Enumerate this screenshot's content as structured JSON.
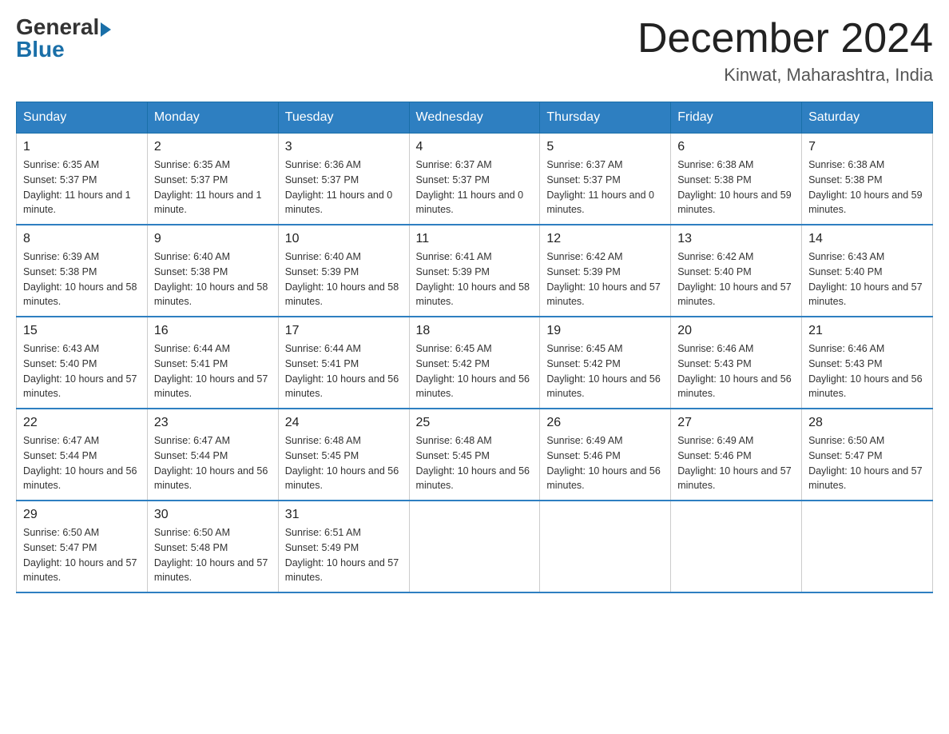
{
  "header": {
    "logo_general": "General",
    "logo_blue": "Blue",
    "month_title": "December 2024",
    "location": "Kinwat, Maharashtra, India"
  },
  "days_of_week": [
    "Sunday",
    "Monday",
    "Tuesday",
    "Wednesday",
    "Thursday",
    "Friday",
    "Saturday"
  ],
  "weeks": [
    [
      {
        "day": "1",
        "sunrise": "6:35 AM",
        "sunset": "5:37 PM",
        "daylight": "11 hours and 1 minute."
      },
      {
        "day": "2",
        "sunrise": "6:35 AM",
        "sunset": "5:37 PM",
        "daylight": "11 hours and 1 minute."
      },
      {
        "day": "3",
        "sunrise": "6:36 AM",
        "sunset": "5:37 PM",
        "daylight": "11 hours and 0 minutes."
      },
      {
        "day": "4",
        "sunrise": "6:37 AM",
        "sunset": "5:37 PM",
        "daylight": "11 hours and 0 minutes."
      },
      {
        "day": "5",
        "sunrise": "6:37 AM",
        "sunset": "5:37 PM",
        "daylight": "11 hours and 0 minutes."
      },
      {
        "day": "6",
        "sunrise": "6:38 AM",
        "sunset": "5:38 PM",
        "daylight": "10 hours and 59 minutes."
      },
      {
        "day": "7",
        "sunrise": "6:38 AM",
        "sunset": "5:38 PM",
        "daylight": "10 hours and 59 minutes."
      }
    ],
    [
      {
        "day": "8",
        "sunrise": "6:39 AM",
        "sunset": "5:38 PM",
        "daylight": "10 hours and 58 minutes."
      },
      {
        "day": "9",
        "sunrise": "6:40 AM",
        "sunset": "5:38 PM",
        "daylight": "10 hours and 58 minutes."
      },
      {
        "day": "10",
        "sunrise": "6:40 AM",
        "sunset": "5:39 PM",
        "daylight": "10 hours and 58 minutes."
      },
      {
        "day": "11",
        "sunrise": "6:41 AM",
        "sunset": "5:39 PM",
        "daylight": "10 hours and 58 minutes."
      },
      {
        "day": "12",
        "sunrise": "6:42 AM",
        "sunset": "5:39 PM",
        "daylight": "10 hours and 57 minutes."
      },
      {
        "day": "13",
        "sunrise": "6:42 AM",
        "sunset": "5:40 PM",
        "daylight": "10 hours and 57 minutes."
      },
      {
        "day": "14",
        "sunrise": "6:43 AM",
        "sunset": "5:40 PM",
        "daylight": "10 hours and 57 minutes."
      }
    ],
    [
      {
        "day": "15",
        "sunrise": "6:43 AM",
        "sunset": "5:40 PM",
        "daylight": "10 hours and 57 minutes."
      },
      {
        "day": "16",
        "sunrise": "6:44 AM",
        "sunset": "5:41 PM",
        "daylight": "10 hours and 57 minutes."
      },
      {
        "day": "17",
        "sunrise": "6:44 AM",
        "sunset": "5:41 PM",
        "daylight": "10 hours and 56 minutes."
      },
      {
        "day": "18",
        "sunrise": "6:45 AM",
        "sunset": "5:42 PM",
        "daylight": "10 hours and 56 minutes."
      },
      {
        "day": "19",
        "sunrise": "6:45 AM",
        "sunset": "5:42 PM",
        "daylight": "10 hours and 56 minutes."
      },
      {
        "day": "20",
        "sunrise": "6:46 AM",
        "sunset": "5:43 PM",
        "daylight": "10 hours and 56 minutes."
      },
      {
        "day": "21",
        "sunrise": "6:46 AM",
        "sunset": "5:43 PM",
        "daylight": "10 hours and 56 minutes."
      }
    ],
    [
      {
        "day": "22",
        "sunrise": "6:47 AM",
        "sunset": "5:44 PM",
        "daylight": "10 hours and 56 minutes."
      },
      {
        "day": "23",
        "sunrise": "6:47 AM",
        "sunset": "5:44 PM",
        "daylight": "10 hours and 56 minutes."
      },
      {
        "day": "24",
        "sunrise": "6:48 AM",
        "sunset": "5:45 PM",
        "daylight": "10 hours and 56 minutes."
      },
      {
        "day": "25",
        "sunrise": "6:48 AM",
        "sunset": "5:45 PM",
        "daylight": "10 hours and 56 minutes."
      },
      {
        "day": "26",
        "sunrise": "6:49 AM",
        "sunset": "5:46 PM",
        "daylight": "10 hours and 56 minutes."
      },
      {
        "day": "27",
        "sunrise": "6:49 AM",
        "sunset": "5:46 PM",
        "daylight": "10 hours and 57 minutes."
      },
      {
        "day": "28",
        "sunrise": "6:50 AM",
        "sunset": "5:47 PM",
        "daylight": "10 hours and 57 minutes."
      }
    ],
    [
      {
        "day": "29",
        "sunrise": "6:50 AM",
        "sunset": "5:47 PM",
        "daylight": "10 hours and 57 minutes."
      },
      {
        "day": "30",
        "sunrise": "6:50 AM",
        "sunset": "5:48 PM",
        "daylight": "10 hours and 57 minutes."
      },
      {
        "day": "31",
        "sunrise": "6:51 AM",
        "sunset": "5:49 PM",
        "daylight": "10 hours and 57 minutes."
      },
      null,
      null,
      null,
      null
    ]
  ]
}
